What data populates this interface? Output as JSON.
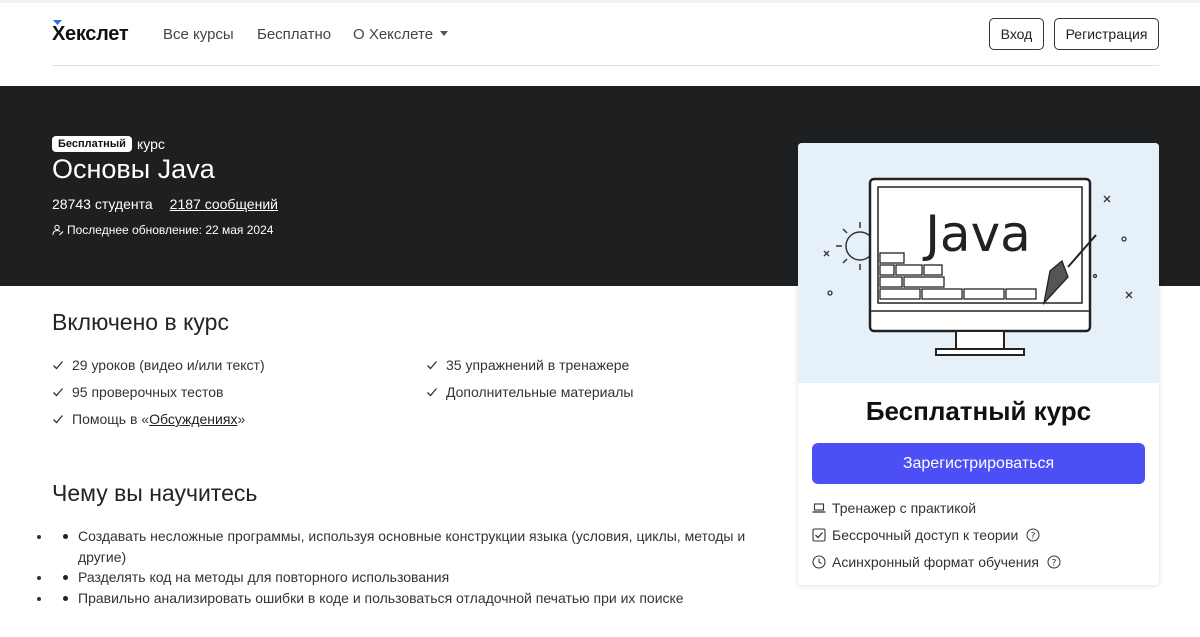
{
  "nav": {
    "logo": "Хекслет",
    "links": [
      "Все курсы",
      "Бесплатно",
      "О Хекслете"
    ],
    "login": "Вход",
    "register": "Регистрация"
  },
  "hero": {
    "badge": "Бесплатный",
    "badge_suffix": "курс",
    "title": "Основы Java",
    "students": "28743 студента",
    "messages": "2187 сообщений",
    "updated": "Последнее обновление: 22 мая 2024"
  },
  "included": {
    "title": "Включено в курс",
    "items": [
      "29 уроков (видео и/или текст)",
      "35 упражнений в тренажере",
      "95 проверочных тестов",
      "Дополнительные материалы"
    ],
    "discussion_prefix": "Помощь в «",
    "discussion_link": "Обсуждениях",
    "discussion_suffix": "»"
  },
  "learn": {
    "title": "Чему вы научитесь",
    "items": [
      "Создавать несложные программы, используя основные конструкции языка (условия, циклы, методы и другие)",
      "Разделять код на методы для повторного использования",
      "Правильно анализировать ошибки в коде и пользоваться отладочной печатью при их поиске"
    ]
  },
  "card": {
    "illustration_text": "Java",
    "price": "Бесплатный курс",
    "cta": "Зарегистрироваться",
    "perks": [
      "Тренажер с практикой",
      "Бессрочный доступ к теории",
      "Асинхронный формат обучения"
    ]
  },
  "colors": {
    "hero_bg": "#1e1f21",
    "cta": "#4b4ff5",
    "illustration_bg": "#e6f0f9"
  }
}
